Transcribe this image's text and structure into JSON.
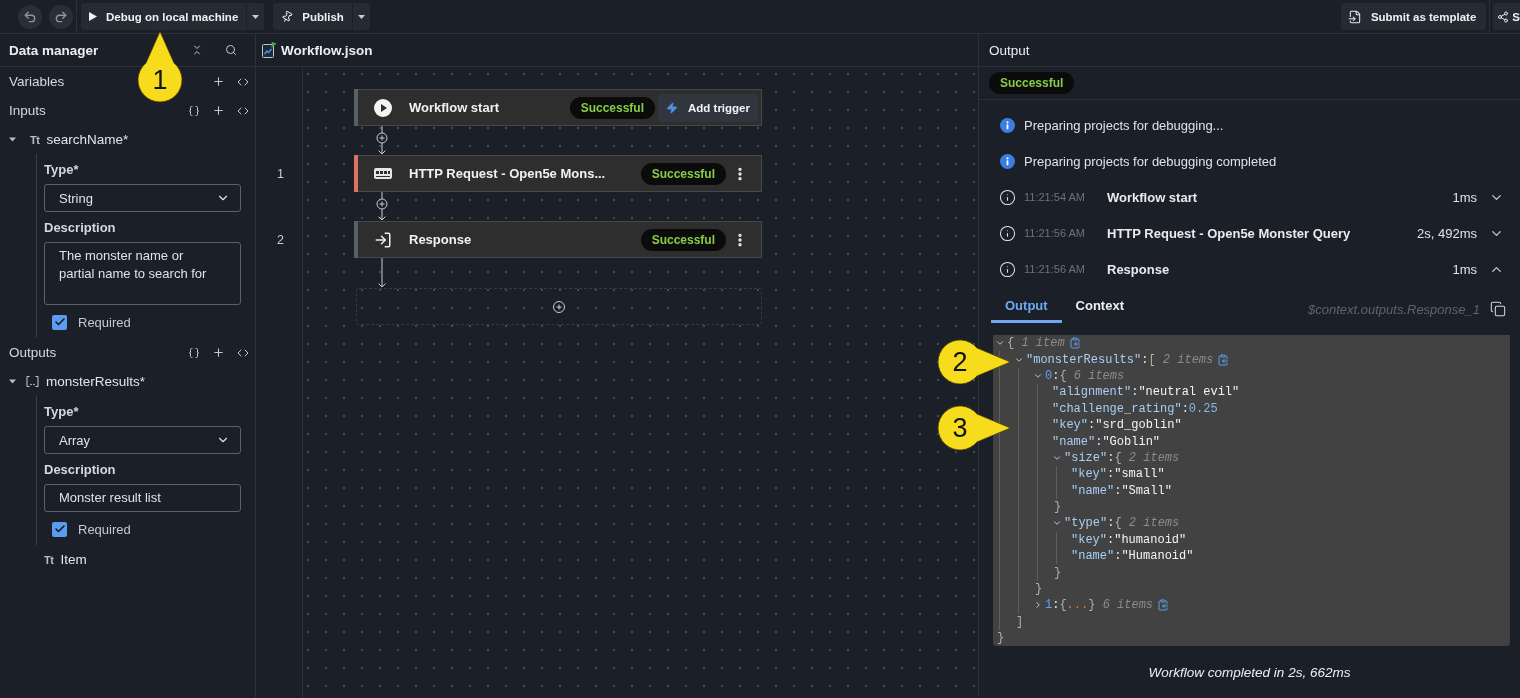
{
  "toolbar": {
    "run_button": {
      "label": "Debug on local machine"
    },
    "publish_button": {
      "label": "Publish"
    },
    "template_button": {
      "label": "Submit as template"
    },
    "share_button": {
      "label": "S"
    }
  },
  "data_manager": {
    "title": "Data manager",
    "sections": [
      {
        "kind": "variables",
        "title": "Variables"
      },
      {
        "kind": "parameters",
        "title": "Inputs",
        "items": [
          {
            "kind": "text",
            "glyph": "Tt",
            "name": "searchName*",
            "expanded": true,
            "type_label": "Type*",
            "type_value": "String",
            "description_label": "Description",
            "description": "The monster name or partial name to search for",
            "description_multiline": true,
            "required_label": "Required",
            "required": true
          }
        ]
      },
      {
        "kind": "parameters",
        "title": "Outputs",
        "items": [
          {
            "kind": "array",
            "name": "monsterResults*",
            "expanded": true,
            "type_label": "Type*",
            "type_value": "Array",
            "description_label": "Description",
            "description": "Monster result list",
            "description_multiline": false,
            "required_label": "Required",
            "required": true,
            "children": [
              {
                "kind": "text",
                "glyph": "Tt",
                "name": "Item"
              }
            ]
          }
        ]
      }
    ]
  },
  "editor": {
    "tab": {
      "title": "Workflow.json"
    },
    "nodes": [
      {
        "kind": "start",
        "title": "Workflow start",
        "status": "Successful",
        "action": "Add trigger",
        "selected": false
      },
      {
        "kind": "http",
        "number": "1",
        "title": "HTTP Request - Open5e Mons...",
        "status": "Successful",
        "selected": true
      },
      {
        "kind": "response",
        "number": "2",
        "title": "Response",
        "status": "Successful",
        "selected": false
      }
    ]
  },
  "output": {
    "title": "Output",
    "status": "Successful",
    "log": [
      {
        "kind": "info",
        "message": "Preparing projects for debugging..."
      },
      {
        "kind": "info",
        "message": "Preparing projects for debugging completed"
      },
      {
        "kind": "step",
        "time": "11:21:54 AM",
        "name": "Workflow start",
        "duration": "1ms",
        "expanded": false
      },
      {
        "kind": "step",
        "time": "11:21:56 AM",
        "name": "HTTP Request - Open5e Monster Query",
        "duration": "2s, 492ms",
        "expanded": false
      },
      {
        "kind": "step",
        "time": "11:21:56 AM",
        "name": "Response",
        "duration": "1ms",
        "expanded": true
      }
    ],
    "tabs": [
      {
        "label": "Output",
        "selected": true
      },
      {
        "label": "Context",
        "selected": false
      }
    ],
    "path": "$context.outputs.Response_1",
    "json": {
      "kind": "root",
      "open": "{",
      "count": "1 item",
      "expanded": true,
      "copy": true,
      "close": "}",
      "children": [
        {
          "kind": "branch",
          "key": "\"monsterResults\"",
          "sep": ":",
          "open": "[",
          "count": "2 items",
          "expanded": true,
          "copy": true,
          "close": "]",
          "children": [
            {
              "kind": "index",
              "key": "0",
              "sep": ":",
              "open": "{",
              "count": "6 items",
              "expanded": true,
              "copy": false,
              "close": "}",
              "children": [
                {
                  "kind": "string",
                  "key": "\"alignment\"",
                  "sep": ":",
                  "value": "\"neutral evil\""
                },
                {
                  "kind": "number",
                  "key": "\"challenge_rating\"",
                  "sep": ":",
                  "value": "0.25"
                },
                {
                  "kind": "string",
                  "key": "\"key\"",
                  "sep": ":",
                  "value": "\"srd_goblin\""
                },
                {
                  "kind": "string",
                  "key": "\"name\"",
                  "sep": ":",
                  "value": "\"Goblin\""
                },
                {
                  "kind": "branch",
                  "key": "\"size\"",
                  "sep": ":",
                  "open": "{",
                  "count": "2 items",
                  "expanded": true,
                  "copy": false,
                  "close": "}",
                  "children": [
                    {
                      "kind": "string",
                      "key": "\"key\"",
                      "sep": ":",
                      "value": "\"small\""
                    },
                    {
                      "kind": "string",
                      "key": "\"name\"",
                      "sep": ":",
                      "value": "\"Small\""
                    }
                  ]
                },
                {
                  "kind": "branch",
                  "key": "\"type\"",
                  "sep": ":",
                  "open": "{",
                  "count": "2 items",
                  "expanded": true,
                  "copy": false,
                  "close": "}",
                  "children": [
                    {
                      "kind": "string",
                      "key": "\"key\"",
                      "sep": ":",
                      "value": "\"humanoid\""
                    },
                    {
                      "kind": "string",
                      "key": "\"name\"",
                      "sep": ":",
                      "value": "\"Humanoid\""
                    }
                  ]
                }
              ]
            },
            {
              "kind": "index",
              "key": "1",
              "sep": ":",
              "open": "{",
              "ellipsis": "...",
              "close": "}",
              "count": "6 items",
              "expanded": false,
              "copy": true
            }
          ]
        }
      ]
    },
    "footer": "Workflow completed in 2s, 662ms"
  },
  "callouts": [
    {
      "label": "1",
      "kind": "up"
    },
    {
      "label": "2",
      "kind": "right"
    },
    {
      "label": "3",
      "kind": "right"
    }
  ]
}
